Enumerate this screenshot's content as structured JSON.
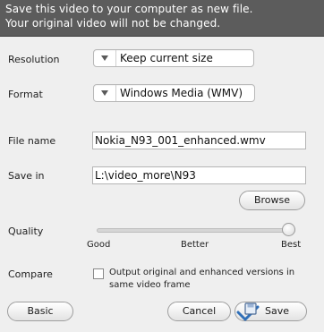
{
  "header": {
    "line1": "Save this video to your computer as new file.",
    "line2": "Your original video will not be changed."
  },
  "resolution": {
    "label": "Resolution",
    "value": "Keep current size"
  },
  "format": {
    "label": "Format",
    "value": "Windows Media (WMV)"
  },
  "file_name": {
    "label": "File name",
    "value": "Nokia_N93_001_enhanced.wmv"
  },
  "save_in": {
    "label": "Save in",
    "value": "L:\\video_more\\N93",
    "browse_label": "Browse"
  },
  "quality": {
    "label": "Quality",
    "ticks": [
      "Good",
      "Better",
      "Best"
    ],
    "level": 1.0
  },
  "compare": {
    "label": "Compare",
    "checkbox_label": "Output original and enhanced versions in same video frame",
    "checked": false
  },
  "footer": {
    "basic_label": "Basic",
    "cancel_label": "Cancel",
    "save_label": "Save"
  },
  "colors": {
    "header_bg": "#5c5c5c",
    "panel_bg": "#efefef"
  },
  "icons": {
    "save": "save-disk-icon",
    "dropdown": "chevron-down-icon"
  }
}
